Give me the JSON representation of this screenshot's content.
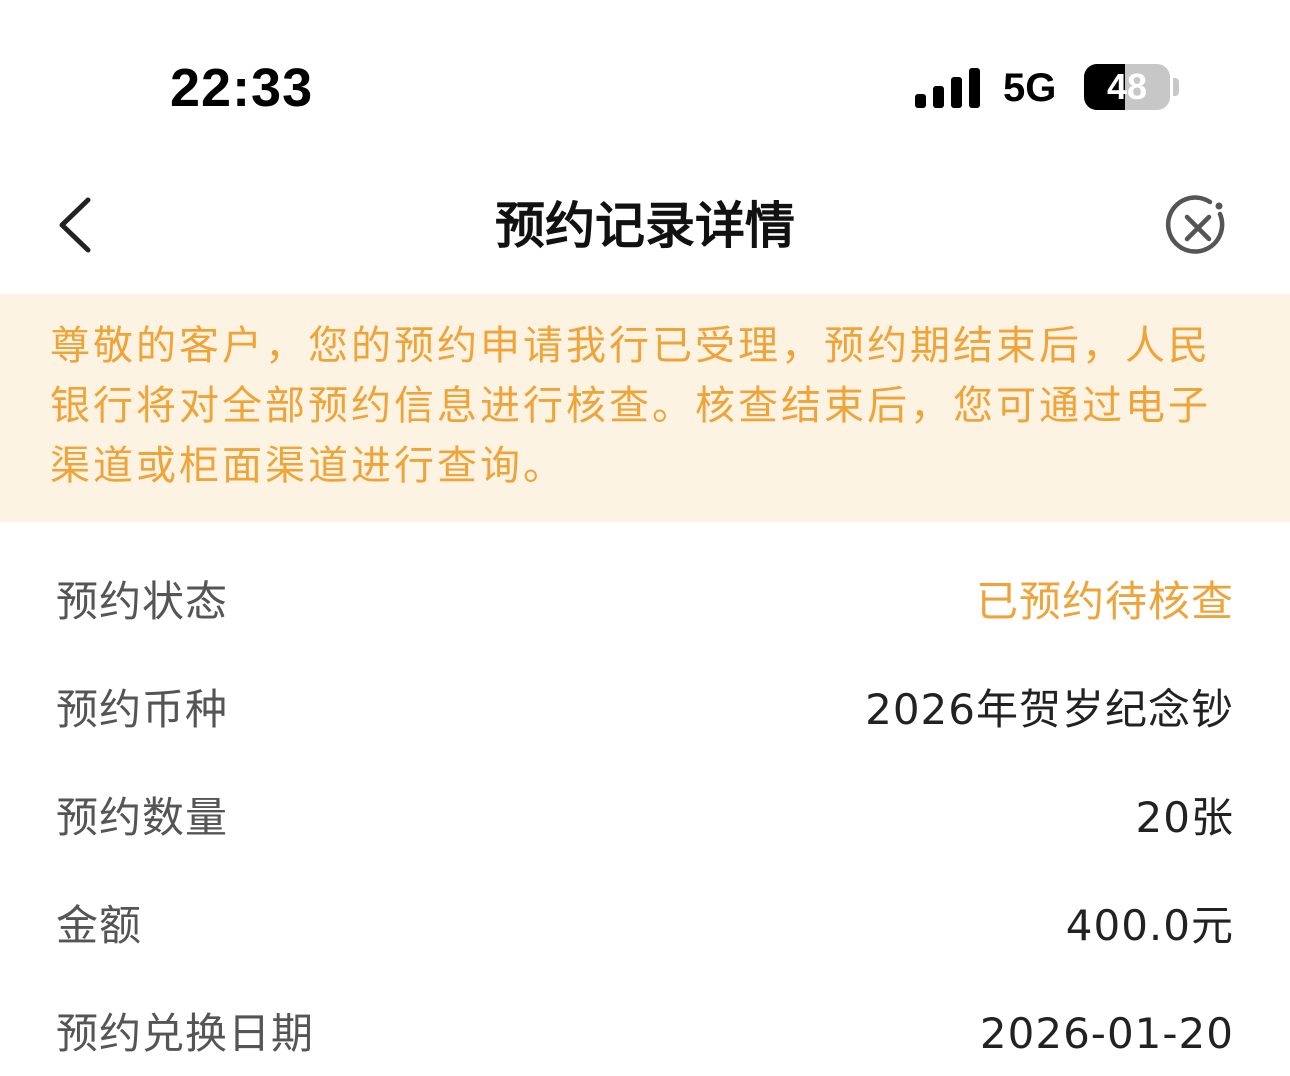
{
  "status_bar": {
    "time": "22:33",
    "network": "5G",
    "battery_level": "48",
    "battery_percent": 48,
    "icons": [
      "signal-icon",
      "battery-icon"
    ]
  },
  "nav": {
    "title": "预约记录详情",
    "back_icon": "chevron-left-icon",
    "close_icon": "close-circle-icon"
  },
  "notice": {
    "text": "尊敬的客户，您的预约申请我行已受理，预约期结束后，人民银行将对全部预约信息进行核查。核查结束后，您可通过电子渠道或柜面渠道进行查询。"
  },
  "details": [
    {
      "label": "预约状态",
      "value": "已预约待核查"
    },
    {
      "label": "预约币种",
      "value": "2026年贺岁纪念钞"
    },
    {
      "label": "预约数量",
      "value": "20张"
    },
    {
      "label": "金额",
      "value": "400.0元"
    },
    {
      "label": "预约兑换日期",
      "value": "2026-01-20"
    }
  ],
  "colors": {
    "accent": "#efa43a",
    "notice_background": "#fdf3e2",
    "label_text": "#555555",
    "value_text": "#222222"
  }
}
